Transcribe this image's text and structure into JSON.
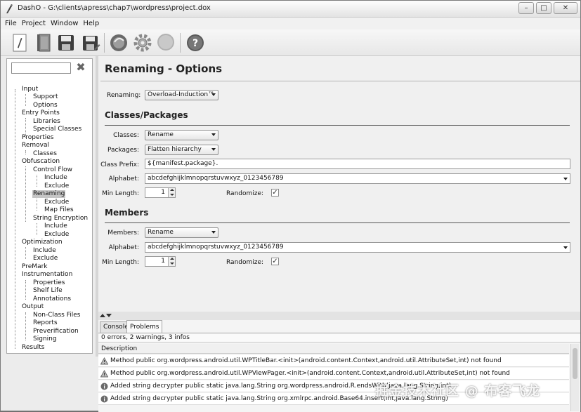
{
  "window": {
    "title": "DashO - G:\\clients\\apress\\chap7\\wordpress\\project.dox",
    "controls": [
      "minimize",
      "maximize",
      "close"
    ]
  },
  "menu": [
    "File",
    "Project",
    "Window",
    "Help"
  ],
  "toolbar": {
    "buttons": [
      {
        "icon": "new-project-icon"
      },
      {
        "icon": "open-project-icon"
      },
      {
        "icon": "save-icon"
      },
      {
        "icon": "save-as-icon"
      },
      {
        "icon": "build-icon"
      },
      {
        "icon": "settings-gear-icon"
      },
      {
        "icon": "stop-icon"
      },
      {
        "icon": "help-icon"
      }
    ]
  },
  "tree": {
    "filter_value": "",
    "items": [
      {
        "label": "Input"
      },
      {
        "label": "Support"
      },
      {
        "label": "Options"
      },
      {
        "label": "Entry Points"
      },
      {
        "label": "Libraries"
      },
      {
        "label": "Special Classes"
      },
      {
        "label": "Properties"
      },
      {
        "label": "Removal"
      },
      {
        "label": "Classes"
      },
      {
        "label": "Obfuscation"
      },
      {
        "label": "Control Flow"
      },
      {
        "label": "Include"
      },
      {
        "label": "Exclude"
      },
      {
        "label": "Renaming",
        "selected": true
      },
      {
        "label": "Exclude"
      },
      {
        "label": "Map Files"
      },
      {
        "label": "String Encryption"
      },
      {
        "label": "Include"
      },
      {
        "label": "Exclude"
      },
      {
        "label": "Optimization"
      },
      {
        "label": "Include"
      },
      {
        "label": "Exclude"
      },
      {
        "label": "PreMark"
      },
      {
        "label": "Instrumentation"
      },
      {
        "label": "Properties"
      },
      {
        "label": "Shelf Life"
      },
      {
        "label": "Annotations"
      },
      {
        "label": "Output"
      },
      {
        "label": "Non-Class Files"
      },
      {
        "label": "Reports"
      },
      {
        "label": "Preverification"
      },
      {
        "label": "Signing"
      },
      {
        "label": "Results"
      }
    ]
  },
  "page": {
    "title": "Renaming - Options",
    "renaming_label": "Renaming:",
    "renaming_value": "Overload-Induction™",
    "classes_section": {
      "title": "Classes/Packages",
      "classes_label": "Classes:",
      "classes_value": "Rename",
      "packages_label": "Packages:",
      "packages_value": "Flatten hierarchy",
      "prefix_label": "Class Prefix:",
      "prefix_value": "${manifest.package}.",
      "alphabet_label": "Alphabet:",
      "alphabet_value": "abcdefghijklmnopqrstuvwxyz_0123456789",
      "minlen_label": "Min Length:",
      "minlen_value": "1",
      "randomize_label": "Randomize:",
      "randomize_checked": "✓"
    },
    "members_section": {
      "title": "Members",
      "members_label": "Members:",
      "members_value": "Rename",
      "alphabet_label": "Alphabet:",
      "alphabet_value": "abcdefghijklmnopqrstuvwxyz_0123456789",
      "minlen_label": "Min Length:",
      "minlen_value": "1",
      "randomize_label": "Randomize:",
      "randomize_checked": "✓"
    }
  },
  "bottom": {
    "tabs": [
      "Console",
      "Problems"
    ],
    "summary": "0 errors, 2 warnings, 3 infos",
    "column": "Description",
    "rows": [
      {
        "type": "warning",
        "text": "Method public org.wordpress.android.util.WPTitleBar.<init>(android.content.Context,android.util.AttributeSet,int) not found"
      },
      {
        "type": "warning",
        "text": "Method public org.wordpress.android.util.WPViewPager.<init>(android.content.Context,android.util.AttributeSet,int) not found"
      },
      {
        "type": "info",
        "text": "Added string decrypter public static java.lang.String org.wordpress.android.R.endsWith(java.lang.String,int)"
      },
      {
        "type": "info",
        "text": "Added string decrypter public static java.lang.String org.xmlrpc.android.Base64.insert(int,java.lang.String)"
      }
    ]
  },
  "watermark": "掘金技术社区 @ 布客飞龙"
}
